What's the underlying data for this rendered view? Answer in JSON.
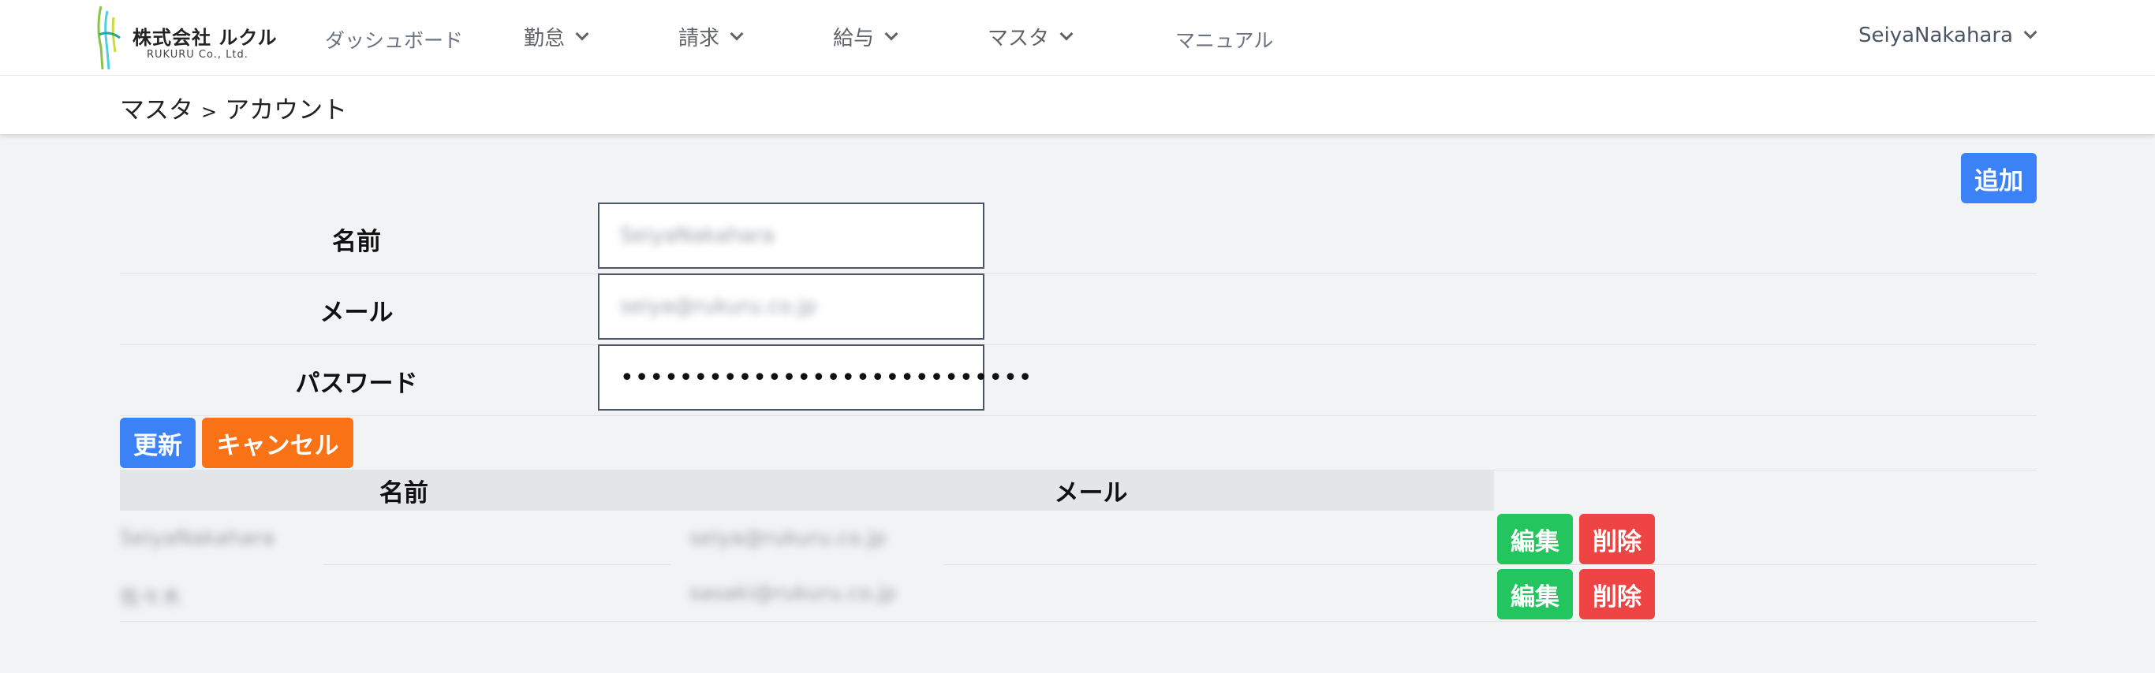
{
  "logo": {
    "brand": "株式会社 ルクル",
    "sub": "RUKURU Co., Ltd."
  },
  "nav": {
    "items": [
      {
        "label": "ダッシュボード",
        "dropdown": false
      },
      {
        "label": "勤怠",
        "dropdown": true
      },
      {
        "label": "請求",
        "dropdown": true
      },
      {
        "label": "給与",
        "dropdown": true
      },
      {
        "label": "マスタ",
        "dropdown": true
      },
      {
        "label": "マニュアル",
        "dropdown": false
      }
    ],
    "user": "SeiyaNakahara"
  },
  "breadcrumb": {
    "parent": "マスタ",
    "separator": ">",
    "current": "アカウント"
  },
  "add_button": "追加",
  "form": {
    "name_label": "名前",
    "name_value": "SeiyaNakahara",
    "email_label": "メール",
    "email_value": "seiya@rukuru.co.jp",
    "password_label": "パスワード",
    "password_value": "••••••••••••••••••••••••••••",
    "update_button": "更新",
    "cancel_button": "キャンセル"
  },
  "table": {
    "headers": [
      "名前",
      "メール"
    ],
    "rows": [
      {
        "name": "SeiyaNakahara",
        "email": "seiya@rukuru.co.jp",
        "edit": "編集",
        "delete": "削除"
      },
      {
        "name": "佐々木",
        "email": "sasaki@rukuru.co.jp",
        "edit": "編集",
        "delete": "削除"
      }
    ]
  },
  "colors": {
    "primary": "#3b82f6",
    "warning": "#f97316",
    "success": "#22c55e",
    "danger": "#ef4444"
  }
}
